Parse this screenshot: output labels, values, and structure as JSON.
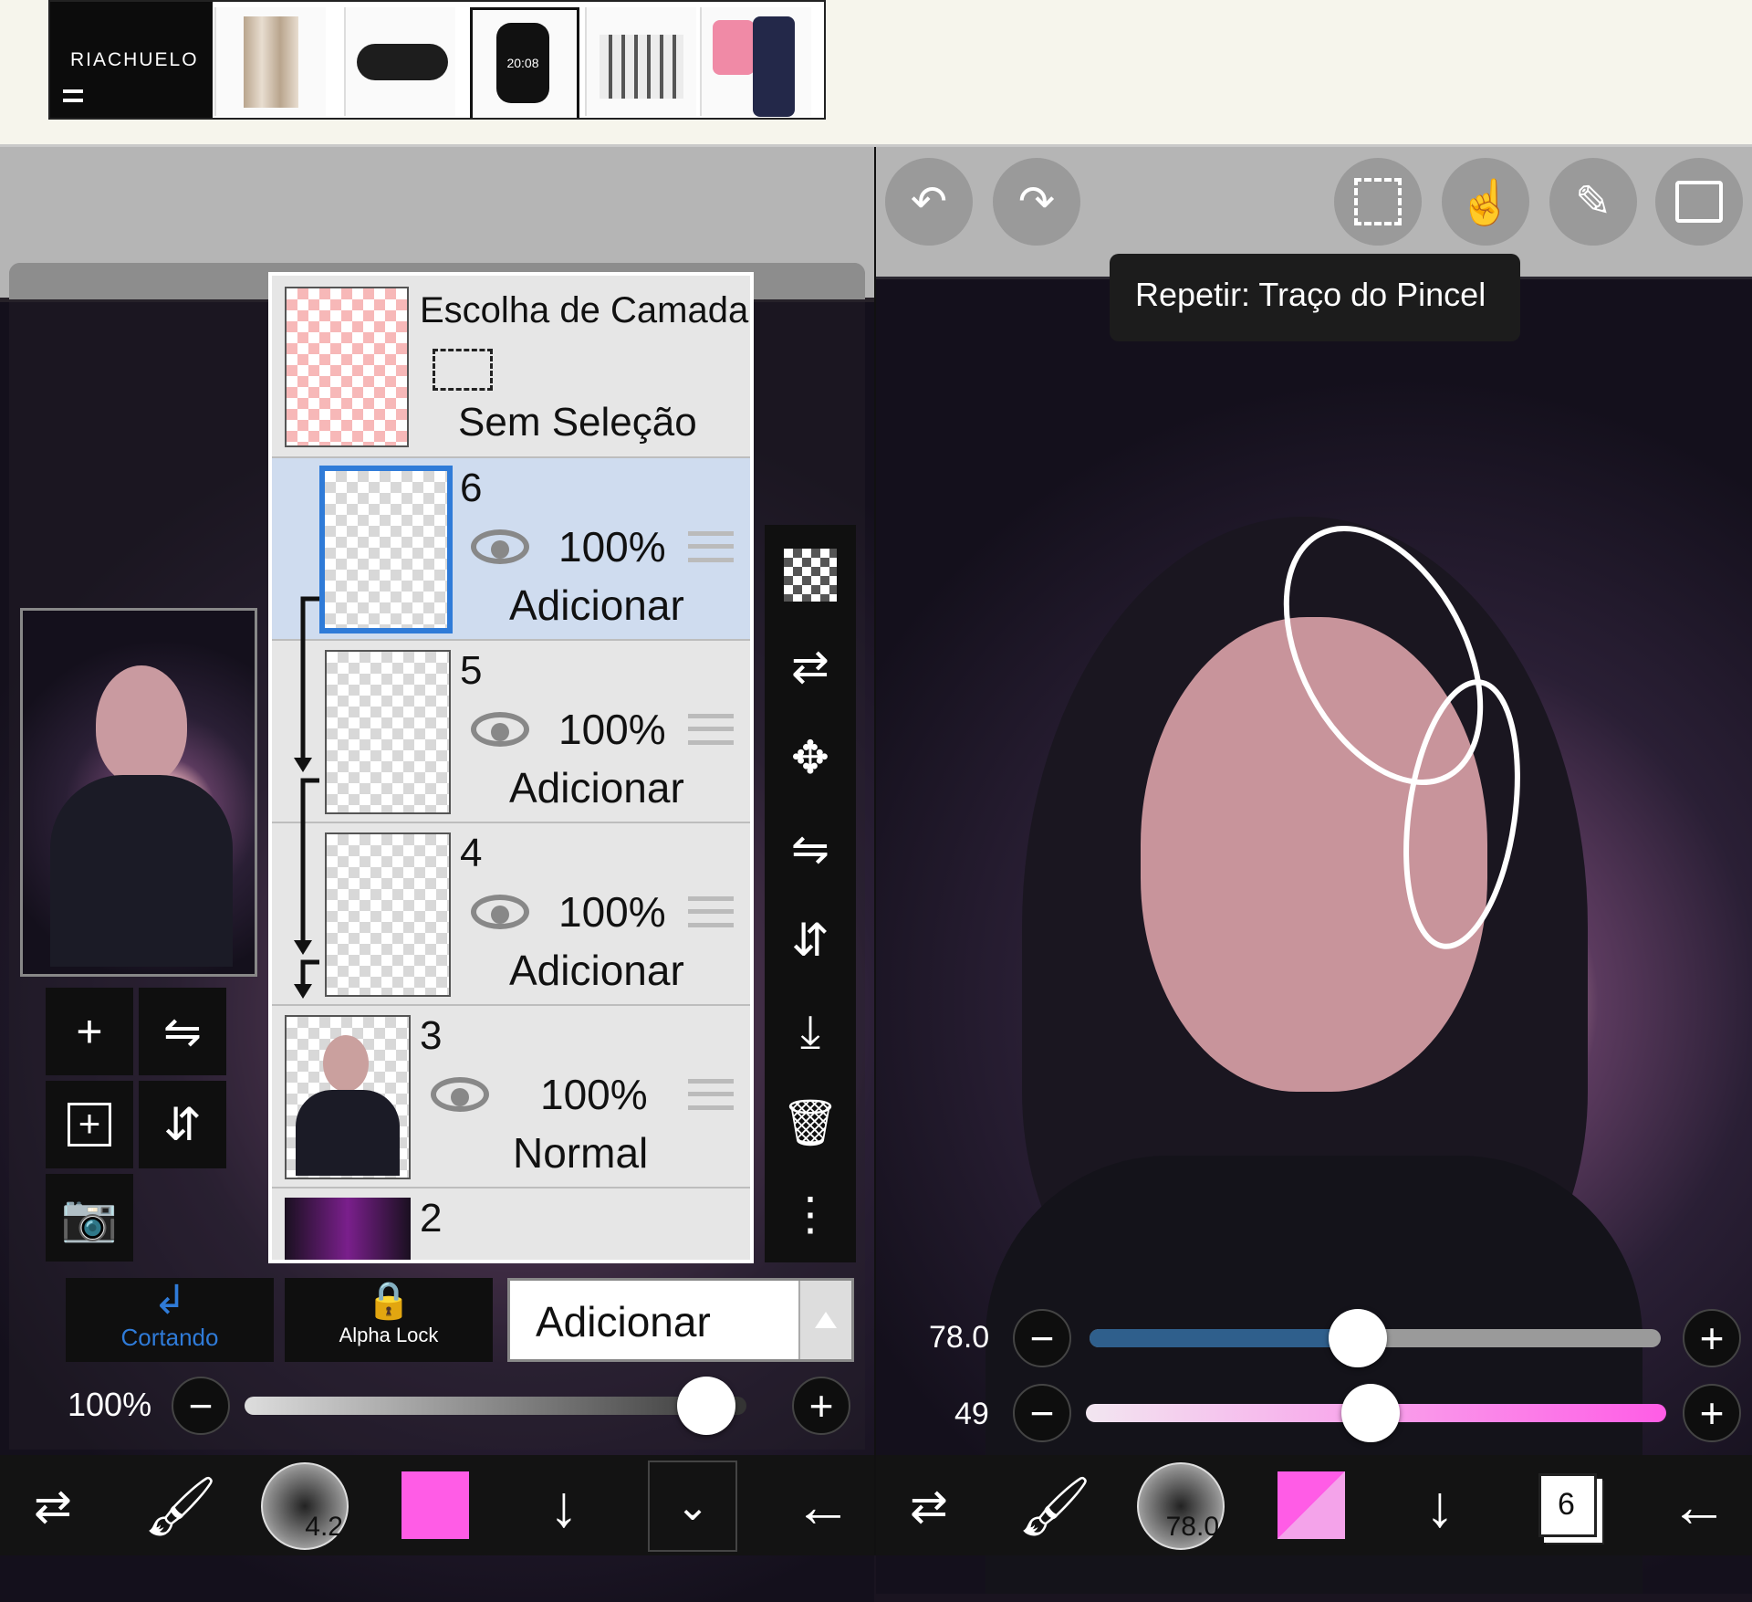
{
  "ad": {
    "brand": "RIACHUELO",
    "products": [
      "curtains",
      "belt",
      "smartwatch",
      "bedding",
      "kids-clothes"
    ],
    "watch_time": "20:08"
  },
  "colors": {
    "accent_blue": "#2f7bd8",
    "layer_selected": "#cfdcef",
    "brush_pink": "#ff5ce6"
  },
  "tooltip": "Repetir: Traço do Pincel",
  "layer_select": {
    "title": "Escolha de Camada",
    "subtitle": "Sem Seleção"
  },
  "layers": [
    {
      "name": "6",
      "opacity": "100%",
      "mode": "Adicionar",
      "selected": true
    },
    {
      "name": "5",
      "opacity": "100%",
      "mode": "Adicionar",
      "selected": false
    },
    {
      "name": "4",
      "opacity": "100%",
      "mode": "Adicionar",
      "selected": false
    },
    {
      "name": "3",
      "opacity": "100%",
      "mode": "Normal",
      "selected": false
    },
    {
      "name": "2"
    }
  ],
  "controls": {
    "clipping_label": "Cortando",
    "alpha_lock_label": "Alpha Lock",
    "blend_mode": "Adicionar",
    "layer_opacity": "100%",
    "layer_opacity_value": 1.0
  },
  "right_sliders": {
    "size_label": "78.0",
    "size_fraction": 0.47,
    "opacity_label": "49",
    "opacity_fraction": 0.49
  },
  "bottom_left": {
    "brush_size": "4.2"
  },
  "bottom_right": {
    "brush_size": "78.0",
    "layer_count": "6"
  }
}
